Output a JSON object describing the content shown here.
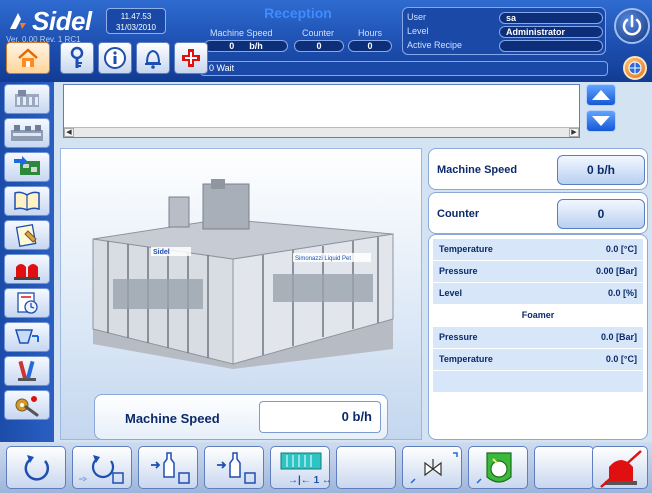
{
  "header": {
    "brand": "Sidel",
    "version": "Ver. 0.00 Rev. 1 RC1",
    "time": "11.47.53",
    "date": "31/03/2010",
    "screen_title": "Reception",
    "counters": {
      "machine_speed_label": "Machine Speed",
      "machine_speed_value": "0",
      "machine_speed_unit": "b/h",
      "counter_label": "Counter",
      "counter_value": "0",
      "hours_label": "Hours",
      "hours_value": "0"
    },
    "user": {
      "user_label": "User",
      "user_value": "sa",
      "level_label": "Level",
      "level_value": "Administrator",
      "recipe_label": "Active Recipe",
      "recipe_value": ""
    },
    "message": "0  Wait"
  },
  "nav_icons": [
    "home-icon",
    "key-icon",
    "info-icon",
    "bell-icon",
    "first-aid-icon"
  ],
  "left_nav": [
    "machine-overview-icon",
    "production-line-icon",
    "io-board-icon",
    "manual-book-icon",
    "recipe-icon",
    "alarm-lights-icon",
    "clock-report-icon",
    "filler-valve-icon",
    "maintenance-tools-icon",
    "settings-wrench-icon"
  ],
  "main": {
    "speed_label": "Machine Speed",
    "speed_value": "0 b/h",
    "machine_logo": "Sidel",
    "machine_brand": "Simonazzi Liquid Pet"
  },
  "right": {
    "machine_speed_label": "Machine Speed",
    "machine_speed_value": "0 b/h",
    "counter_label": "Counter",
    "counter_value": "0",
    "params": [
      {
        "label": "Temperature",
        "value": "0.0 [°C]"
      },
      {
        "label": "Pressure",
        "value": "0.00 [Bar]"
      },
      {
        "label": "Level",
        "value": "0.0 [%]"
      },
      {
        "section": "Foamer"
      },
      {
        "label": "Pressure",
        "value": "0.0  [Bar]"
      },
      {
        "label": "Temperature",
        "value": "0.0    [°C]"
      }
    ]
  },
  "toolbar": [
    "reset-cycle-icon",
    "cycle-start-icon",
    "bottle-feed-icon",
    "bottle-empty-icon",
    "single-step-icon",
    "blank",
    "valve-icon",
    "green-release-icon",
    "blank",
    "emergency-stop-icon"
  ],
  "colors": {
    "header_blue": "#1d4fb0",
    "title_blue": "#3d8dff",
    "panel_row": "#d7e6f8",
    "alarm_red": "#e01010"
  }
}
